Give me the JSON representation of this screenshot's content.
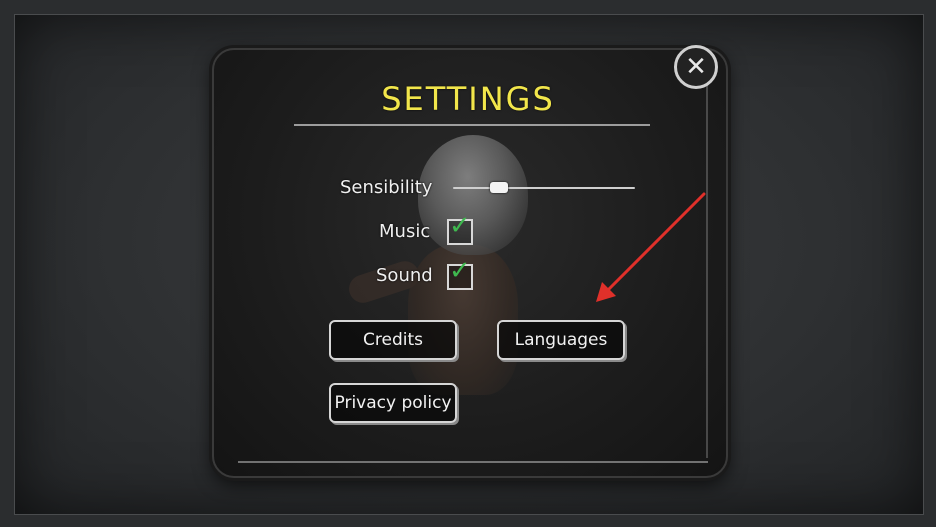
{
  "title": "SETTINGS",
  "close_icon": "close-x-icon",
  "settings": {
    "sensibility_label": "Sensibility",
    "sensibility_value": 0.25,
    "music_label": "Music",
    "music_checked": true,
    "sound_label": "Sound",
    "sound_checked": true
  },
  "buttons": {
    "credits": "Credits",
    "languages": "Languages",
    "privacy": "Privacy policy"
  },
  "colors": {
    "title": "#f2e64b",
    "check": "#3fb84f",
    "arrow": "#e0302a"
  }
}
